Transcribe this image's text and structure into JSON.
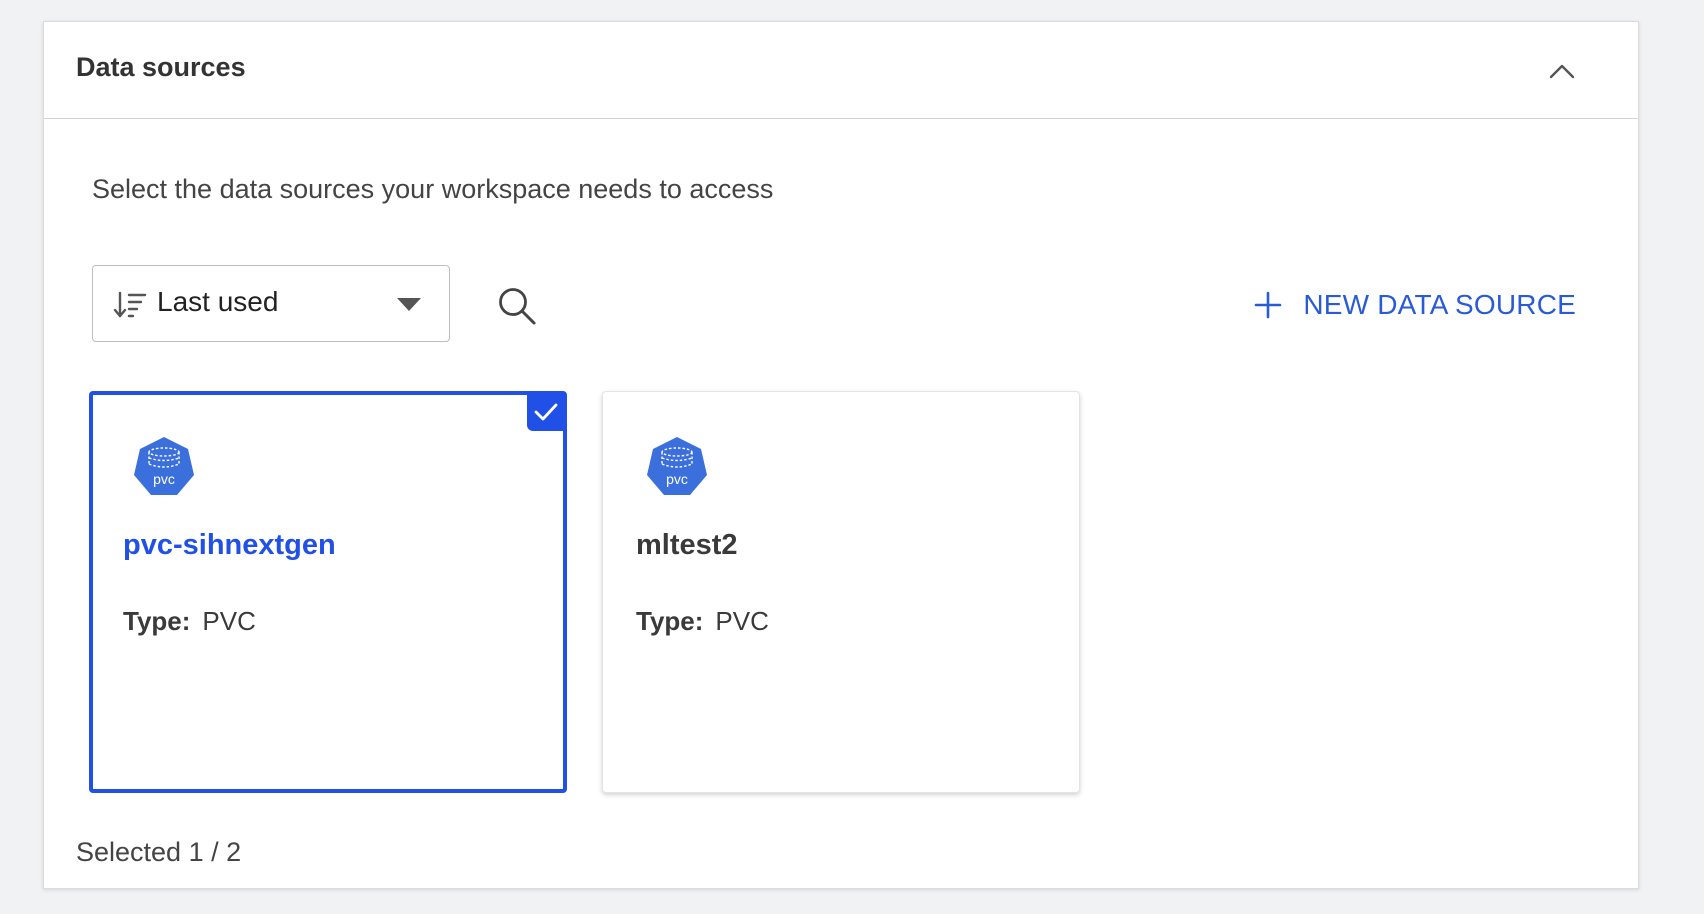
{
  "panel": {
    "title": "Data sources",
    "subtitle": "Select the data sources your workspace needs to access",
    "collapse_icon": "chevron-up-icon"
  },
  "toolbar": {
    "sort": {
      "value": "Last used",
      "icon": "sort-descending-icon"
    },
    "search_icon": "search-icon",
    "new_button": {
      "label": "NEW DATA SOURCE",
      "icon": "plus-icon"
    }
  },
  "cards": [
    {
      "name": "pvc-sihnextgen",
      "type_label": "Type:",
      "type_value": "PVC",
      "icon_text": "pvc",
      "selected": true
    },
    {
      "name": "mltest2",
      "type_label": "Type:",
      "type_value": "PVC",
      "icon_text": "pvc",
      "selected": false
    }
  ],
  "footer": {
    "selection_count": "Selected 1 / 2"
  },
  "colors": {
    "accent": "#2150e6",
    "link": "#2a5bd7",
    "pvc_icon": "#3b6fdc"
  }
}
